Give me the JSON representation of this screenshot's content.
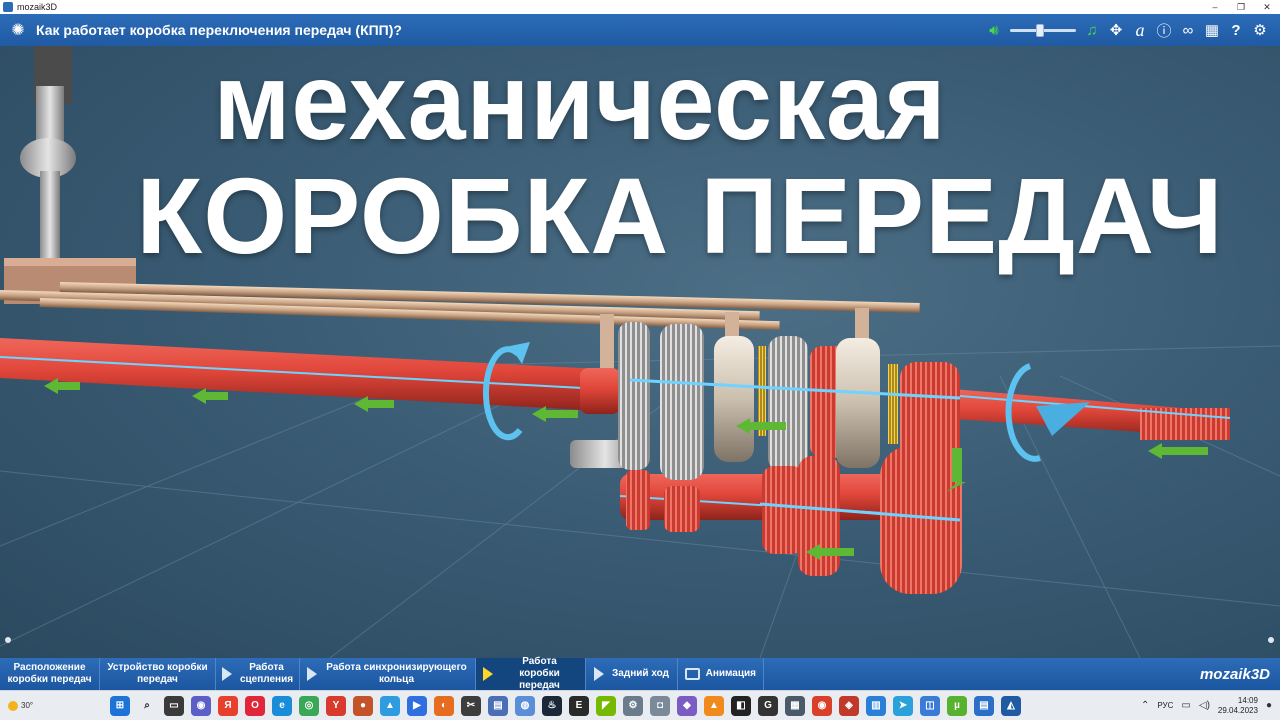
{
  "window": {
    "app_name": "mozaik3D",
    "controls": [
      "–",
      "❐",
      "✕"
    ]
  },
  "header": {
    "title": "Как работает коробка переключения передач (КПП)?",
    "volume_level": 0.45,
    "tools": [
      {
        "name": "speaker-icon",
        "glyph": "🔊︎"
      },
      {
        "name": "music-icon",
        "glyph": "♫"
      },
      {
        "name": "move-icon",
        "glyph": "✥"
      },
      {
        "name": "font-icon",
        "glyph": "a"
      },
      {
        "name": "info-icon",
        "glyph": "ⓘ"
      },
      {
        "name": "link-icon",
        "glyph": "∞"
      },
      {
        "name": "grid-icon",
        "glyph": "▦"
      },
      {
        "name": "help-icon",
        "glyph": "?"
      },
      {
        "name": "settings-icon",
        "glyph": "⚙"
      }
    ]
  },
  "scene": {
    "headline_line1": "механическая",
    "headline_line2": "КОРОБКА  ПЕРЕДАЧ"
  },
  "bottom_nav": {
    "items": [
      {
        "label": "Расположение коробки передач",
        "icon": "none"
      },
      {
        "label": "Устройство коробки передач",
        "icon": "none"
      },
      {
        "label": "Работа сцепления",
        "icon": "play"
      },
      {
        "label": "Работа синхронизирующего кольца",
        "icon": "play"
      },
      {
        "label": "Работа коробки передач",
        "icon": "play",
        "active": true
      },
      {
        "label": "Задний ход",
        "icon": "play"
      },
      {
        "label": "Анимация",
        "icon": "tv"
      }
    ],
    "brand": "mozaik3D"
  },
  "taskbar": {
    "weather": "30°",
    "language": "РУС",
    "time": "14:09",
    "date": "29.04.2023",
    "apps": [
      {
        "name": "windows-start-icon",
        "color": "#1e73d6",
        "glyph": "⊞"
      },
      {
        "name": "search-icon",
        "color": "#e9edf2",
        "glyph": "⌕"
      },
      {
        "name": "task-view-icon",
        "color": "#3a3a3a",
        "glyph": "▭"
      },
      {
        "name": "meet-icon",
        "color": "#5b5fc7",
        "glyph": "◉"
      },
      {
        "name": "yandex-icon",
        "color": "#e8402f",
        "glyph": "Я"
      },
      {
        "name": "opera-icon",
        "color": "#e2263a",
        "glyph": "O"
      },
      {
        "name": "edge-icon",
        "color": "#1a8dd8",
        "glyph": "e"
      },
      {
        "name": "chrome-icon",
        "color": "#3aa757",
        "glyph": "◎"
      },
      {
        "name": "yandex-browser-icon",
        "color": "#d83a2b",
        "glyph": "Y"
      },
      {
        "name": "screen-recorder-icon",
        "color": "#c4532a",
        "glyph": "●"
      },
      {
        "name": "photos-icon",
        "color": "#2f9be0",
        "glyph": "▲"
      },
      {
        "name": "media-player-icon",
        "color": "#2f6fe0",
        "glyph": "▶"
      },
      {
        "name": "firefox-icon",
        "color": "#e66d1f",
        "glyph": "◐"
      },
      {
        "name": "video-editor-icon",
        "color": "#3d3d3d",
        "glyph": "✂"
      },
      {
        "name": "presentation-icon",
        "color": "#4a6fb5",
        "glyph": "▤"
      },
      {
        "name": "chromium-icon",
        "color": "#5a8fd8",
        "glyph": "◍"
      },
      {
        "name": "steam-icon",
        "color": "#1b2838",
        "glyph": "♨"
      },
      {
        "name": "epic-games-icon",
        "color": "#2a2a2a",
        "glyph": "E"
      },
      {
        "name": "nvidia-icon",
        "color": "#76b900",
        "glyph": "◤"
      },
      {
        "name": "gear-app-icon",
        "color": "#6a7b8c",
        "glyph": "⚙"
      },
      {
        "name": "camera-icon",
        "color": "#7b8a99",
        "glyph": "◘"
      },
      {
        "name": "voice-icon",
        "color": "#7b5cc2",
        "glyph": "◆"
      },
      {
        "name": "vlc-icon",
        "color": "#f08a1c",
        "glyph": "▲"
      },
      {
        "name": "capcut-icon",
        "color": "#222222",
        "glyph": "◧"
      },
      {
        "name": "g-app-icon",
        "color": "#333333",
        "glyph": "G"
      },
      {
        "name": "calculator-icon",
        "color": "#4a5a6a",
        "glyph": "▦"
      },
      {
        "name": "scrap-icon",
        "color": "#d8402a",
        "glyph": "◉"
      },
      {
        "name": "red-app-icon",
        "color": "#c0392b",
        "glyph": "◈"
      },
      {
        "name": "notes-icon",
        "color": "#2a7fd8",
        "glyph": "▥"
      },
      {
        "name": "telegram-icon",
        "color": "#2aa1da",
        "glyph": "➤"
      },
      {
        "name": "monitor-icon",
        "color": "#3a7bd5",
        "glyph": "◫"
      },
      {
        "name": "utorrent-icon",
        "color": "#58b12f",
        "glyph": "µ"
      },
      {
        "name": "document-icon",
        "color": "#2b6fc9",
        "glyph": "▤"
      },
      {
        "name": "mozaik-icon",
        "color": "#1f5aa3",
        "glyph": "◭"
      }
    ]
  }
}
